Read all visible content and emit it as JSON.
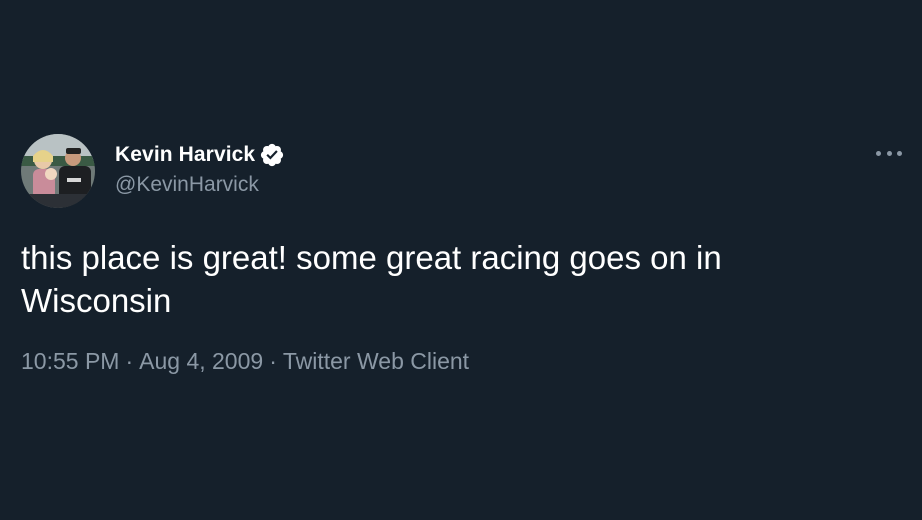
{
  "user": {
    "display_name": "Kevin Harvick",
    "handle": "@KevinHarvick",
    "verified": true
  },
  "tweet": {
    "text": "this place is great! some great racing goes on in Wisconsin",
    "time": "10:55 PM",
    "separator": "·",
    "date": "Aug 4, 2009",
    "source": "Twitter Web Client"
  },
  "icons": {
    "verified": "verified-badge-icon",
    "more": "more-options-icon"
  },
  "colors": {
    "background": "#15202b",
    "primary_text": "#ffffff",
    "secondary_text": "#8b98a5"
  }
}
